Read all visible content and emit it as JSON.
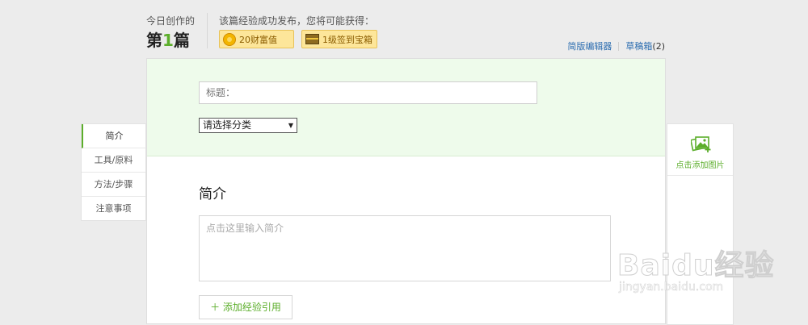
{
  "header": {
    "today_label": "今日创作的",
    "count_prefix": "第",
    "count_number": "1",
    "count_suffix": "篇",
    "reward_title": "该篇经验成功发布，您将可能获得：",
    "badges": [
      {
        "label": "20财富值",
        "icon": "coin-icon"
      },
      {
        "label": "1级签到宝箱",
        "icon": "treasure-chest-icon"
      }
    ],
    "links": {
      "simple_editor": "简版编辑器",
      "drafts": "草稿箱",
      "drafts_count": "(2)"
    }
  },
  "leftnav": {
    "items": [
      {
        "label": "简介"
      },
      {
        "label": "工具/原料"
      },
      {
        "label": "方法/步骤"
      },
      {
        "label": "注意事项"
      }
    ]
  },
  "editor": {
    "title_placeholder": "标题：",
    "category_selected": "请选择分类",
    "intro_heading": "简介",
    "intro_placeholder": "点击这里输入简介",
    "add_reference": "＋  添加经验引用"
  },
  "rightpanel": {
    "add_image_label": "点击添加图片",
    "icon": "add-image-icon"
  },
  "watermark": {
    "brand": "Baidu经验",
    "url": "jingyan.baidu.com"
  },
  "colors": {
    "accent_green": "#5cae2b",
    "badge_bg": "#fde69a",
    "link_blue": "#2c6db0",
    "green_panel": "#eefbeb"
  }
}
